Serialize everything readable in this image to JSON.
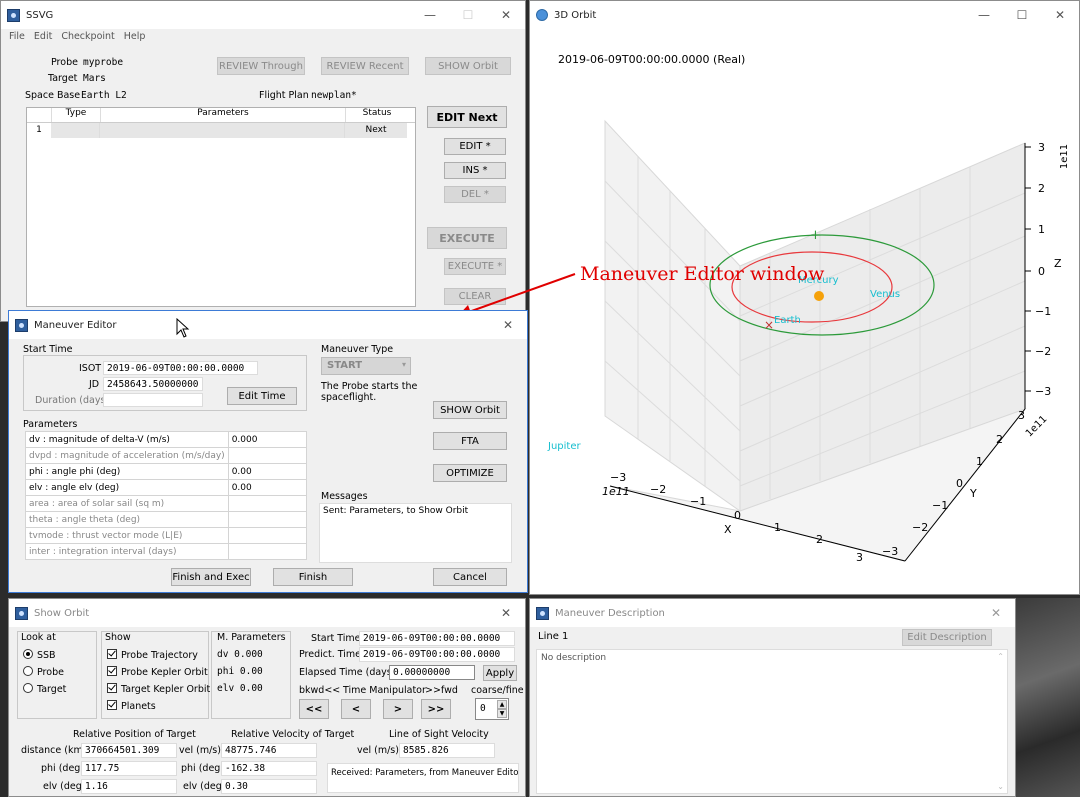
{
  "ssvg": {
    "title": "SSVG",
    "menu": [
      "File",
      "Edit",
      "Checkpoint",
      "Help"
    ],
    "probe_label": "Probe",
    "probe_value": "myprobe",
    "target_label": "Target",
    "target_value": "Mars",
    "base_label": "Space Base",
    "base_value": "Earth L2",
    "plan_label": "Flight Plan",
    "plan_value": "newplan*",
    "review_through": "REVIEW Through",
    "review_recent": "REVIEW Recent",
    "show_orbit": "SHOW Orbit",
    "table_headers": [
      "Type",
      "Parameters",
      "Status"
    ],
    "row": {
      "num": "1",
      "type": "",
      "params": "",
      "status": "Next"
    },
    "edit_next": "EDIT Next",
    "edit": "EDIT *",
    "ins": "INS *",
    "del": "DEL *",
    "execute": "EXECUTE",
    "execute_star": "EXECUTE *",
    "clear": "CLEAR"
  },
  "maneuver_editor": {
    "title": "Maneuver Editor",
    "start_time": "Start Time",
    "isot_label": "ISOT",
    "isot_value": "2019-06-09T00:00:00.0000",
    "jd_label": "JD",
    "jd_value": "2458643.50000000",
    "duration_label": "Duration (days)",
    "duration_value": "",
    "edit_time": "Edit Time",
    "parameters": "Parameters",
    "params": [
      {
        "name": "dv   : magnitude of delta-V (m/s)",
        "value": "0.000"
      },
      {
        "name": "dvpd : magnitude of acceleration (m/s/day)",
        "value": ""
      },
      {
        "name": "phi   : angle phi (deg)",
        "value": "0.00"
      },
      {
        "name": "elv   : angle elv (deg)",
        "value": "0.00"
      },
      {
        "name": "area   : area of solar sail (sq m)",
        "value": ""
      },
      {
        "name": "theta : angle theta (deg)",
        "value": ""
      },
      {
        "name": "tvmode : thrust vector mode (L|E)",
        "value": ""
      },
      {
        "name": "inter : integration interval (days)",
        "value": ""
      }
    ],
    "maneuver_type": "Maneuver Type",
    "type_value": "START",
    "desc": "The Probe starts the spaceflight.",
    "show_orbit": "SHOW Orbit",
    "fta": "FTA",
    "optimize": "OPTIMIZE",
    "messages": "Messages",
    "message_text": "Sent: Parameters, to Show Orbit",
    "finish_exec": "Finish and Exec",
    "finish": "Finish",
    "cancel": "Cancel"
  },
  "orbit3d": {
    "title": "3D Orbit",
    "timestamp": "2019-06-09T00:00:00.0000 (Real)",
    "xlabel": "X",
    "ylabel": "Y",
    "zlabel": "Z",
    "x_ticks": [
      "−3",
      "−2",
      "−1",
      "0",
      "1",
      "2",
      "3"
    ],
    "y_ticks": [
      "−3",
      "−2",
      "−1",
      "0",
      "1",
      "2",
      "3"
    ],
    "z_ticks": [
      "−3",
      "−2",
      "−1",
      "0",
      "1",
      "2",
      "3"
    ],
    "scale": "1e11",
    "planets": [
      "Mercury",
      "Venus",
      "Earth",
      "Jupiter"
    ],
    "colors": {
      "earth_orbit": "#e8383c",
      "mars_orbit": "#2c9a3a",
      "sun": "#f5a10a",
      "label": "#17becf"
    },
    "annotation": "Maneuver Editor window",
    "annotation_color": "#e00000"
  },
  "show_orbit": {
    "title": "Show Orbit",
    "look_at": "Look at",
    "look_options": [
      "SSB",
      "Probe",
      "Target"
    ],
    "show": "Show",
    "show_options": [
      "Probe Trajectory",
      "Probe Kepler Orbit",
      "Target Kepler Orbit",
      "Planets"
    ],
    "m_params": "M. Parameters",
    "dv": "dv 0.000",
    "phi": "phi 0.00",
    "elv": "elv 0.00",
    "start_time_label": "Start Time",
    "start_time": "2019-06-09T00:00:00.0000",
    "predict_label": "Predict. Time",
    "predict_time": "2019-06-09T00:00:00.0000",
    "elapsed_label": "Elapsed Time (days)",
    "elapsed_value": "0.00000000",
    "apply": "Apply",
    "bkwd": "bkwd<<",
    "time_manip": "Time Manipulator",
    "fwd": ">>fwd",
    "coarse": "coarse/fine",
    "nav": [
      "<<",
      "<",
      ">",
      ">>"
    ],
    "spin_value": "0",
    "rel_pos": "Relative Position of Target",
    "distance_label": "distance (km)",
    "distance": "370664501.309",
    "phi_label": "phi (deg)",
    "phi_pos": "117.75",
    "elv_label": "elv (deg)",
    "elv_pos": "1.16",
    "rel_vel": "Relative Velocity of Target",
    "vel_label": "vel (m/s)",
    "vel": "48775.746",
    "phi_vel": "-162.38",
    "elv_vel": "0.30",
    "los": "Line of Sight Velocity",
    "los_vel": "8585.826",
    "received": "Received: Parameters, from Maneuver Editor"
  },
  "maneuver_desc": {
    "title": "Maneuver Description",
    "line": "Line 1",
    "edit_desc": "Edit Description",
    "no_desc": "No description"
  }
}
